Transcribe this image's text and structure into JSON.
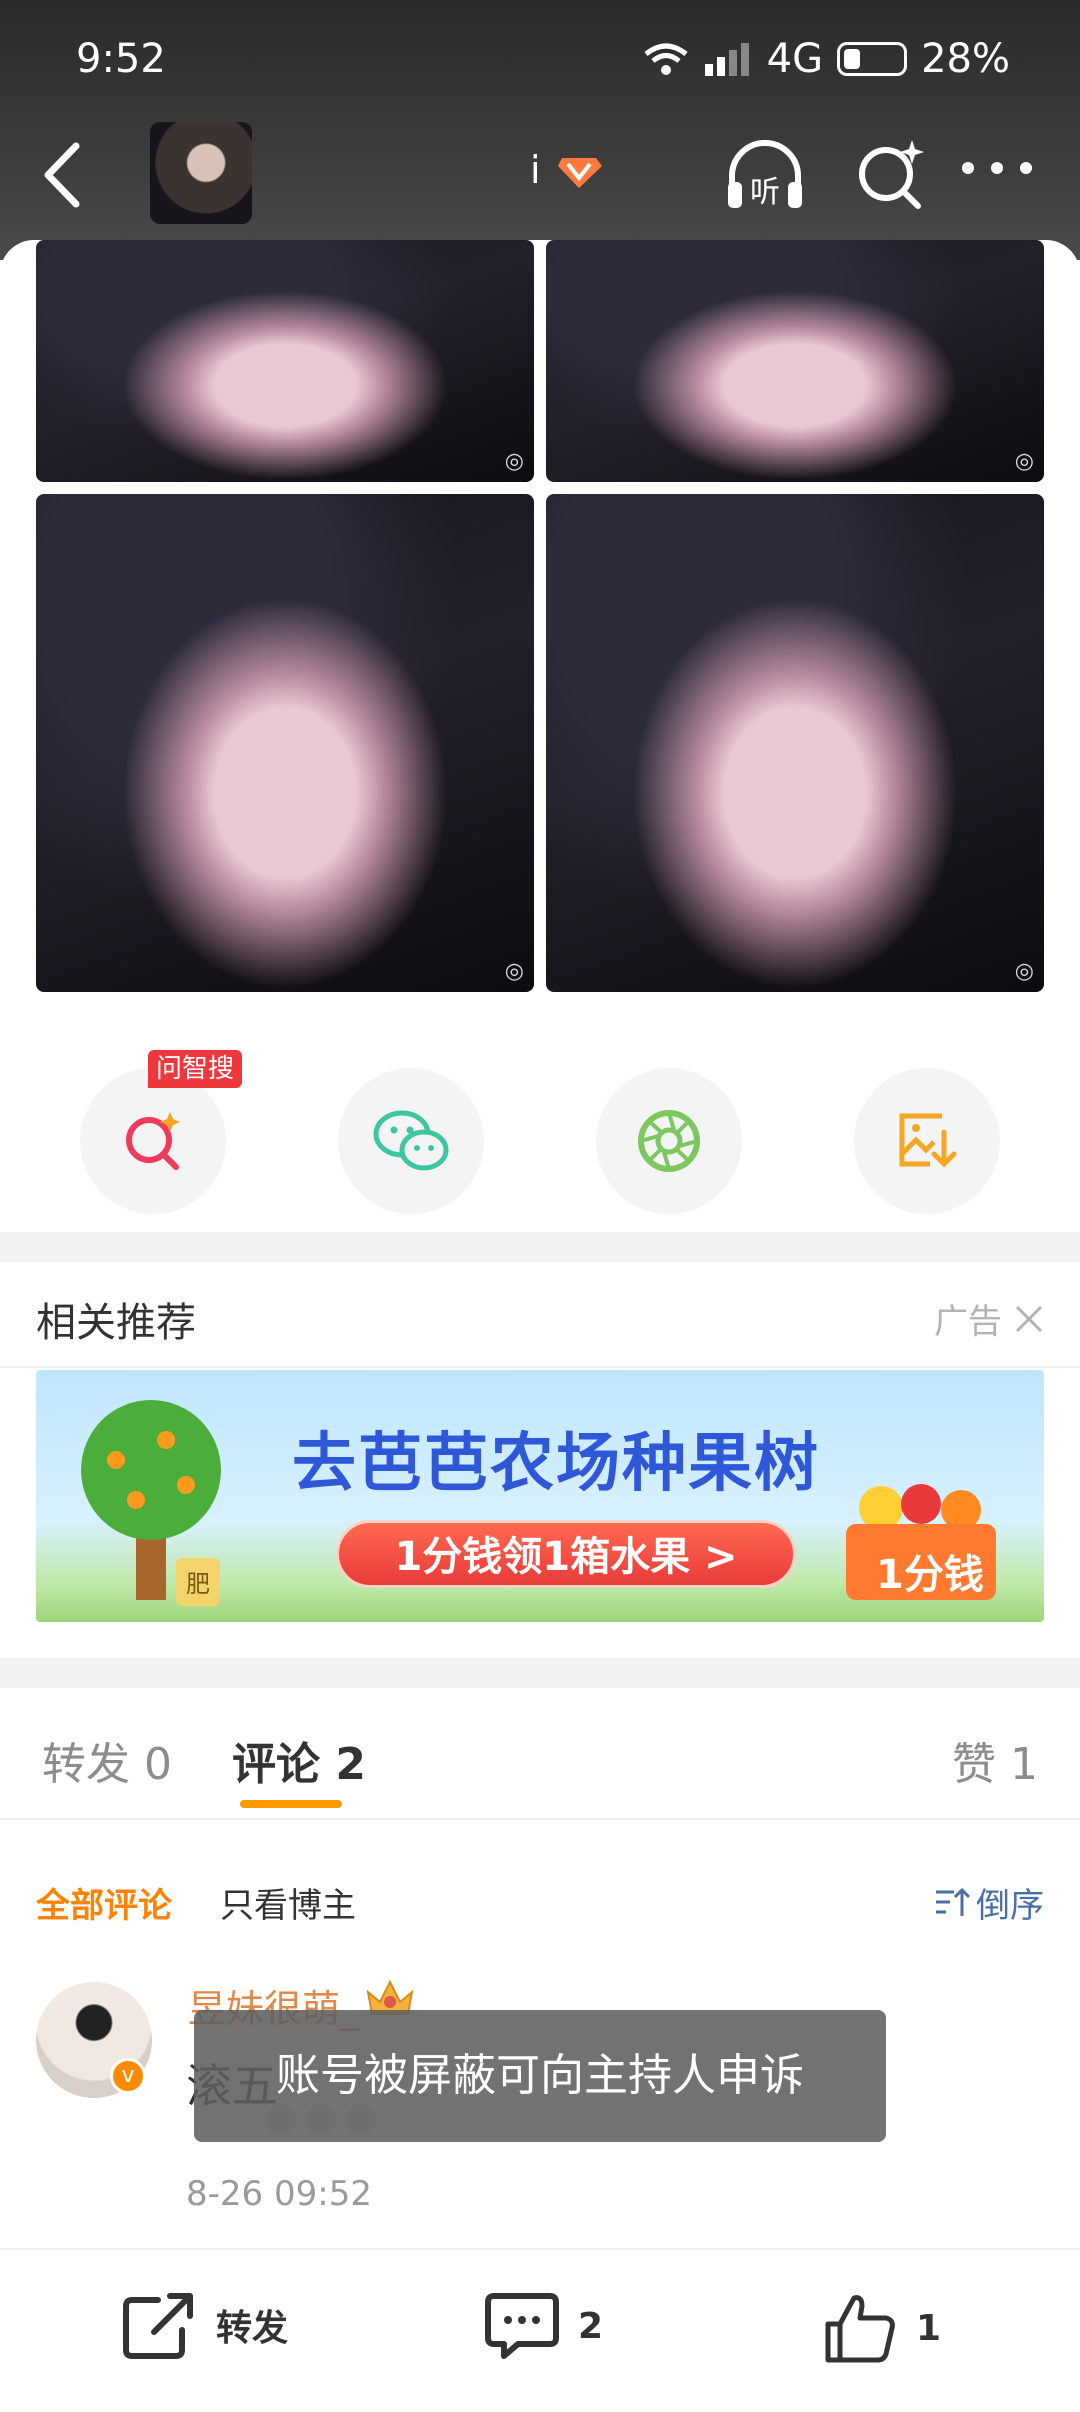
{
  "status_bar": {
    "time": "9:52",
    "network": "4G",
    "battery": "28%"
  },
  "nav": {
    "username_fragment": "i",
    "icons": [
      "back-icon",
      "listen-icon",
      "search-spark-icon",
      "more-icon"
    ],
    "listen_label": "听"
  },
  "share_actions": {
    "ask_tag": "问智搜",
    "icons": [
      "ask-search-icon",
      "wechat-icon",
      "moments-icon",
      "save-image-icon"
    ]
  },
  "recommend": {
    "title": "相关推荐",
    "ad_label": "广告",
    "banner": {
      "headline": "去芭芭农场种果树",
      "button": "1分钱领1箱水果 >",
      "price_tag": "1分钱",
      "fertilizer": "肥"
    }
  },
  "tabs": {
    "repost": "转发 0",
    "comment": "评论 2",
    "like": "赞 1"
  },
  "filters": {
    "all": "全部评论",
    "owner_only": "只看博主",
    "sort": "倒序"
  },
  "comment": {
    "username": "昱妹很萌_",
    "text": "滚五",
    "time": "8-26 09:52"
  },
  "toast": "账号被屏蔽可向主持人申诉",
  "bottom_bar": {
    "repost": "转发",
    "comment_count": "2",
    "like_count": "1"
  },
  "colors": {
    "accent_orange": "#ff8200",
    "tab_underline": "#ff9a00",
    "ask_tag_red": "#f0383c",
    "wechat_green": "#3cc7a0",
    "moments_green": "#7cc75e",
    "save_orange": "#f5a623"
  }
}
